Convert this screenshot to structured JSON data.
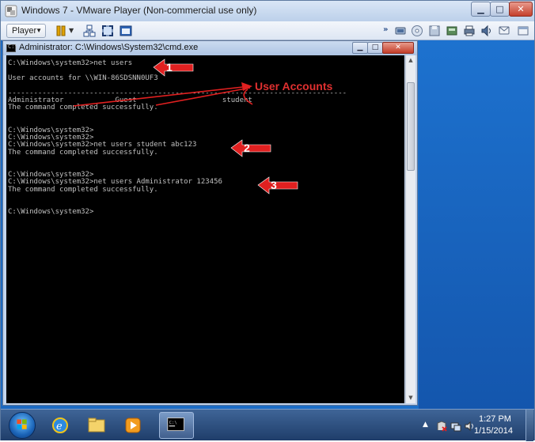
{
  "vmware": {
    "title": "Windows 7 - VMware Player (Non-commercial use only)",
    "player_menu": "Player",
    "icons": [
      "vmware-logo-icon",
      "pause-icon",
      "dropdown-caret-icon",
      "network-icon",
      "fullscreen-icon",
      "unity-icon",
      "more-icon",
      "usb-icon",
      "cd-icon",
      "floppy-icon",
      "hdd-icon",
      "printer-icon",
      "sound-icon",
      "message-icon"
    ]
  },
  "cmd": {
    "title": "Administrator: C:\\Windows\\System32\\cmd.exe",
    "lines": [
      "C:\\Windows\\system32>net users",
      "",
      "User accounts for \\\\WIN-86SDSNN0UF3",
      "",
      "-------------------------------------------------------------------------------",
      "Administrator            Guest                    student",
      "The command completed successfully.",
      "",
      "",
      "C:\\Windows\\system32>",
      "C:\\Windows\\system32>",
      "C:\\Windows\\system32>net users student abc123",
      "The command completed successfully.",
      "",
      "",
      "C:\\Windows\\system32>",
      "C:\\Windows\\system32>net users Administrator 123456",
      "The command completed successfully.",
      "",
      "",
      "C:\\Windows\\system32>"
    ]
  },
  "annotations": {
    "user_accounts": "User Accounts",
    "step1": "1",
    "step2": "2",
    "step3": "3",
    "color": "#e02020"
  },
  "taskbar": {
    "time": "1:27 PM",
    "date": "1/15/2014",
    "icons": [
      "start-orb-icon",
      "internet-explorer-icon",
      "windows-explorer-icon",
      "media-player-icon",
      "command-prompt-icon",
      "show-hidden-icons-icon",
      "network-status-icon",
      "action-center-icon",
      "volume-icon"
    ]
  }
}
